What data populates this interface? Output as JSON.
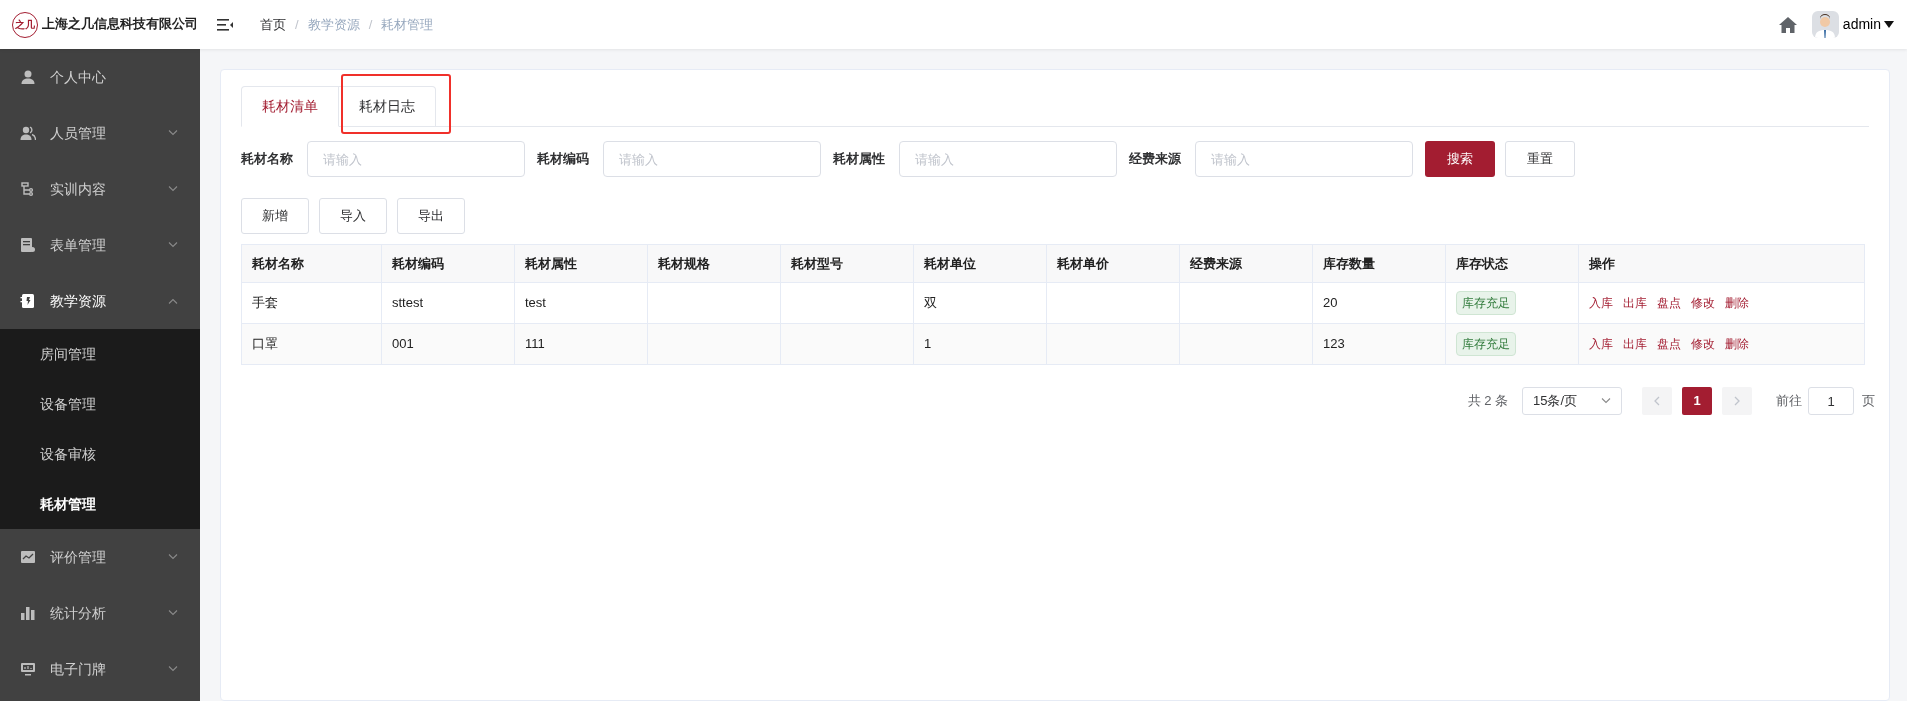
{
  "header": {
    "company": "上海之几信息科技有限公司",
    "logo_text": "之几",
    "breadcrumb": [
      {
        "label": "首页",
        "current": false
      },
      {
        "label": "教学资源",
        "current": true
      },
      {
        "label": "耗材管理",
        "current": true
      }
    ],
    "separator": "/",
    "user": "admin"
  },
  "sidebar": {
    "items": [
      {
        "label": "个人中心",
        "expanded": false,
        "has_children": false
      },
      {
        "label": "人员管理",
        "expanded": false,
        "has_children": true
      },
      {
        "label": "实训内容",
        "expanded": false,
        "has_children": true
      },
      {
        "label": "表单管理",
        "expanded": false,
        "has_children": true
      },
      {
        "label": "教学资源",
        "expanded": true,
        "has_children": true,
        "children": [
          {
            "label": "房间管理",
            "selected": false
          },
          {
            "label": "设备管理",
            "selected": false
          },
          {
            "label": "设备审核",
            "selected": false
          },
          {
            "label": "耗材管理",
            "selected": true
          }
        ]
      },
      {
        "label": "评价管理",
        "expanded": false,
        "has_children": true
      },
      {
        "label": "统计分析",
        "expanded": false,
        "has_children": true
      },
      {
        "label": "电子门牌",
        "expanded": false,
        "has_children": true
      }
    ]
  },
  "tabs": [
    {
      "label": "耗材清单",
      "selected": true,
      "highlighted": false
    },
    {
      "label": "耗材日志",
      "selected": false,
      "highlighted": true
    }
  ],
  "filters": [
    {
      "label": "耗材名称",
      "placeholder": "请输入"
    },
    {
      "label": "耗材编码",
      "placeholder": "请输入"
    },
    {
      "label": "耗材属性",
      "placeholder": "请输入"
    },
    {
      "label": "经费来源",
      "placeholder": "请输入"
    }
  ],
  "search_buttons": [
    {
      "label": "搜索",
      "kind": "primary"
    },
    {
      "label": "重置",
      "kind": "plain"
    }
  ],
  "actions": [
    "新增",
    "导入",
    "导出"
  ],
  "table": {
    "columns": [
      "耗材名称",
      "耗材编码",
      "耗材属性",
      "耗材规格",
      "耗材型号",
      "耗材单位",
      "耗材单价",
      "经费来源",
      "库存数量",
      "库存状态",
      "操作"
    ],
    "rows": [
      {
        "cells": [
          "手套",
          "sttest",
          "test",
          "",
          "",
          "双",
          "",
          "",
          "20"
        ],
        "status": "库存充足",
        "ops": [
          "入库",
          "出库",
          "盘点",
          "修改",
          "删除"
        ]
      },
      {
        "cells": [
          "口罩",
          "001",
          "111",
          "",
          "",
          "1",
          "",
          "",
          "123"
        ],
        "status": "库存充足",
        "ops": [
          "入库",
          "出库",
          "盘点",
          "修改",
          "删除"
        ]
      }
    ]
  },
  "pagination": {
    "total": "共 2 条",
    "page_size": "15条/页",
    "pages": [
      {
        "label": "1",
        "selected": true
      }
    ],
    "goto_label": "前往",
    "goto_value": "1",
    "page_suffix": "页"
  }
}
